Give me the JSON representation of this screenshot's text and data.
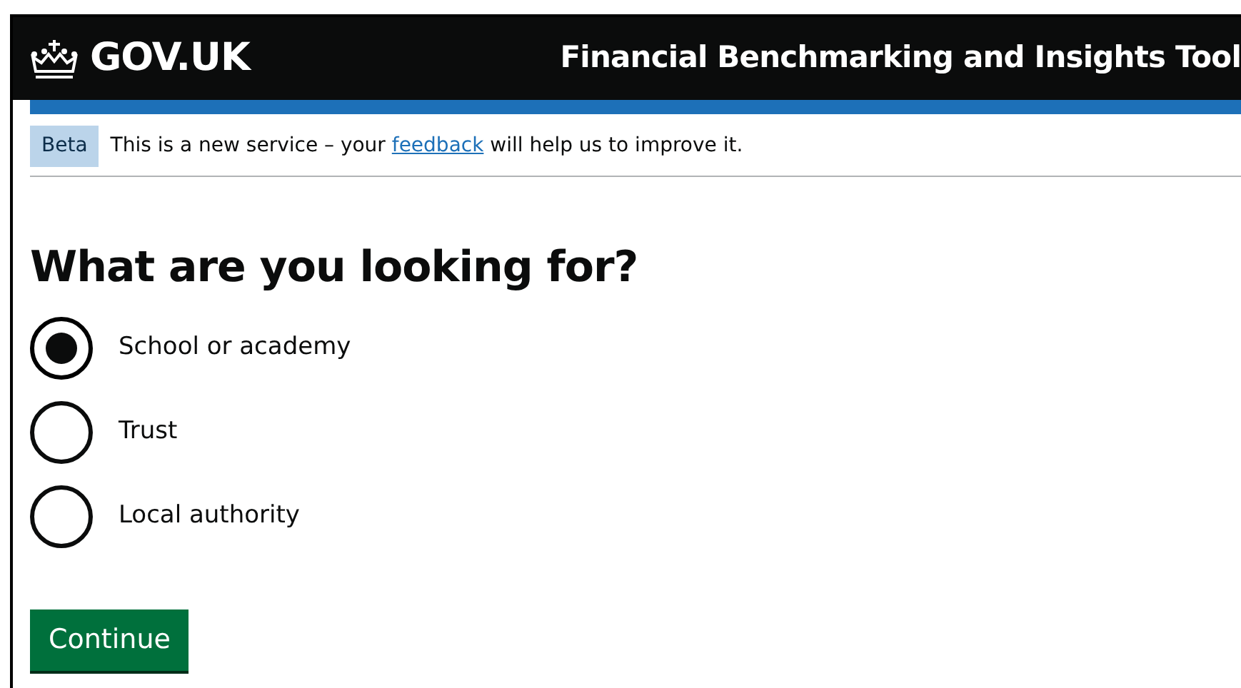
{
  "header": {
    "logo": "GOV.UK",
    "service_name": "Financial Benchmarking and Insights Tool"
  },
  "phase_banner": {
    "tag": "Beta",
    "text_before": "This is a new service – your",
    "link": "feedback",
    "text_after": "will help us to improve it."
  },
  "heading": "What are you looking for?",
  "options": [
    {
      "label": "School or academy",
      "selected": true
    },
    {
      "label": "Trust",
      "selected": false
    },
    {
      "label": "Local authority",
      "selected": false
    }
  ],
  "button": "Continue"
}
